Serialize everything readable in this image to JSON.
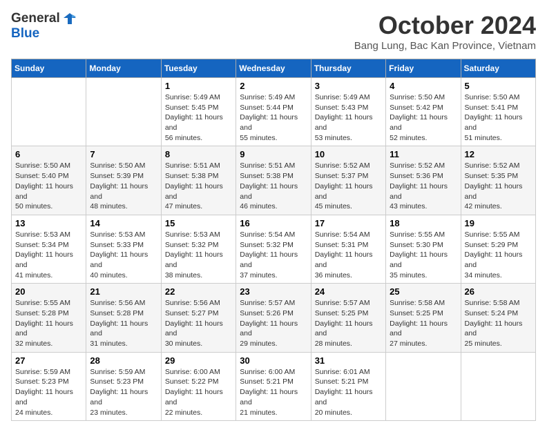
{
  "logo": {
    "general": "General",
    "blue": "Blue"
  },
  "title": "October 2024",
  "location": "Bang Lung, Bac Kan Province, Vietnam",
  "weekdays": [
    "Sunday",
    "Monday",
    "Tuesday",
    "Wednesday",
    "Thursday",
    "Friday",
    "Saturday"
  ],
  "weeks": [
    [
      {
        "day": "",
        "info": ""
      },
      {
        "day": "",
        "info": ""
      },
      {
        "day": "1",
        "info": "Sunrise: 5:49 AM\nSunset: 5:45 PM\nDaylight: 11 hours and 56 minutes."
      },
      {
        "day": "2",
        "info": "Sunrise: 5:49 AM\nSunset: 5:44 PM\nDaylight: 11 hours and 55 minutes."
      },
      {
        "day": "3",
        "info": "Sunrise: 5:49 AM\nSunset: 5:43 PM\nDaylight: 11 hours and 53 minutes."
      },
      {
        "day": "4",
        "info": "Sunrise: 5:50 AM\nSunset: 5:42 PM\nDaylight: 11 hours and 52 minutes."
      },
      {
        "day": "5",
        "info": "Sunrise: 5:50 AM\nSunset: 5:41 PM\nDaylight: 11 hours and 51 minutes."
      }
    ],
    [
      {
        "day": "6",
        "info": "Sunrise: 5:50 AM\nSunset: 5:40 PM\nDaylight: 11 hours and 50 minutes."
      },
      {
        "day": "7",
        "info": "Sunrise: 5:50 AM\nSunset: 5:39 PM\nDaylight: 11 hours and 48 minutes."
      },
      {
        "day": "8",
        "info": "Sunrise: 5:51 AM\nSunset: 5:38 PM\nDaylight: 11 hours and 47 minutes."
      },
      {
        "day": "9",
        "info": "Sunrise: 5:51 AM\nSunset: 5:38 PM\nDaylight: 11 hours and 46 minutes."
      },
      {
        "day": "10",
        "info": "Sunrise: 5:52 AM\nSunset: 5:37 PM\nDaylight: 11 hours and 45 minutes."
      },
      {
        "day": "11",
        "info": "Sunrise: 5:52 AM\nSunset: 5:36 PM\nDaylight: 11 hours and 43 minutes."
      },
      {
        "day": "12",
        "info": "Sunrise: 5:52 AM\nSunset: 5:35 PM\nDaylight: 11 hours and 42 minutes."
      }
    ],
    [
      {
        "day": "13",
        "info": "Sunrise: 5:53 AM\nSunset: 5:34 PM\nDaylight: 11 hours and 41 minutes."
      },
      {
        "day": "14",
        "info": "Sunrise: 5:53 AM\nSunset: 5:33 PM\nDaylight: 11 hours and 40 minutes."
      },
      {
        "day": "15",
        "info": "Sunrise: 5:53 AM\nSunset: 5:32 PM\nDaylight: 11 hours and 38 minutes."
      },
      {
        "day": "16",
        "info": "Sunrise: 5:54 AM\nSunset: 5:32 PM\nDaylight: 11 hours and 37 minutes."
      },
      {
        "day": "17",
        "info": "Sunrise: 5:54 AM\nSunset: 5:31 PM\nDaylight: 11 hours and 36 minutes."
      },
      {
        "day": "18",
        "info": "Sunrise: 5:55 AM\nSunset: 5:30 PM\nDaylight: 11 hours and 35 minutes."
      },
      {
        "day": "19",
        "info": "Sunrise: 5:55 AM\nSunset: 5:29 PM\nDaylight: 11 hours and 34 minutes."
      }
    ],
    [
      {
        "day": "20",
        "info": "Sunrise: 5:55 AM\nSunset: 5:28 PM\nDaylight: 11 hours and 32 minutes."
      },
      {
        "day": "21",
        "info": "Sunrise: 5:56 AM\nSunset: 5:28 PM\nDaylight: 11 hours and 31 minutes."
      },
      {
        "day": "22",
        "info": "Sunrise: 5:56 AM\nSunset: 5:27 PM\nDaylight: 11 hours and 30 minutes."
      },
      {
        "day": "23",
        "info": "Sunrise: 5:57 AM\nSunset: 5:26 PM\nDaylight: 11 hours and 29 minutes."
      },
      {
        "day": "24",
        "info": "Sunrise: 5:57 AM\nSunset: 5:25 PM\nDaylight: 11 hours and 28 minutes."
      },
      {
        "day": "25",
        "info": "Sunrise: 5:58 AM\nSunset: 5:25 PM\nDaylight: 11 hours and 27 minutes."
      },
      {
        "day": "26",
        "info": "Sunrise: 5:58 AM\nSunset: 5:24 PM\nDaylight: 11 hours and 25 minutes."
      }
    ],
    [
      {
        "day": "27",
        "info": "Sunrise: 5:59 AM\nSunset: 5:23 PM\nDaylight: 11 hours and 24 minutes."
      },
      {
        "day": "28",
        "info": "Sunrise: 5:59 AM\nSunset: 5:23 PM\nDaylight: 11 hours and 23 minutes."
      },
      {
        "day": "29",
        "info": "Sunrise: 6:00 AM\nSunset: 5:22 PM\nDaylight: 11 hours and 22 minutes."
      },
      {
        "day": "30",
        "info": "Sunrise: 6:00 AM\nSunset: 5:21 PM\nDaylight: 11 hours and 21 minutes."
      },
      {
        "day": "31",
        "info": "Sunrise: 6:01 AM\nSunset: 5:21 PM\nDaylight: 11 hours and 20 minutes."
      },
      {
        "day": "",
        "info": ""
      },
      {
        "day": "",
        "info": ""
      }
    ]
  ]
}
